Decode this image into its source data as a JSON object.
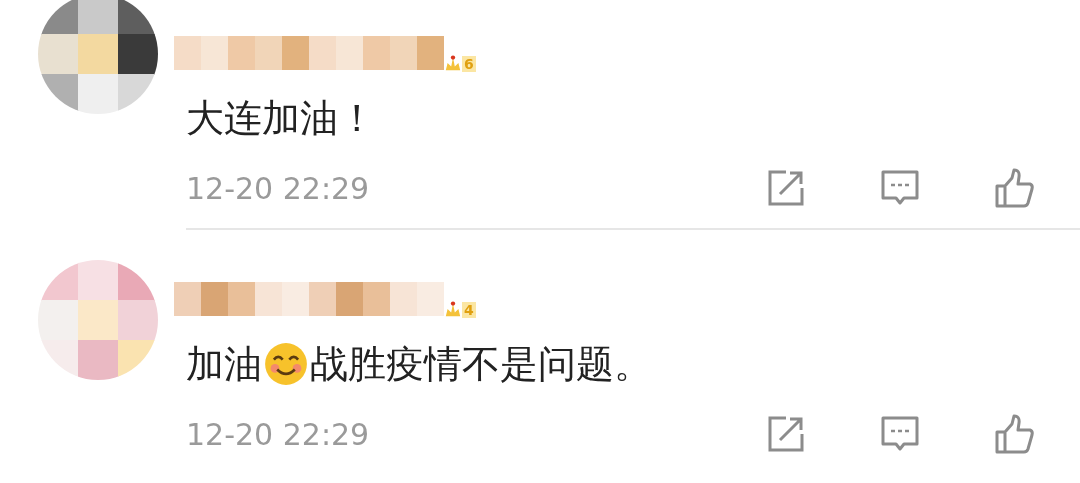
{
  "comments": [
    {
      "avatar": {
        "kind": "picture"
      },
      "name": {
        "kind": "picture"
      },
      "badge": {
        "level": "6"
      },
      "segments": [
        {
          "kind": "text",
          "text": "大连加油！"
        }
      ],
      "time": "12-20 22:29"
    },
    {
      "avatar": {
        "kind": "picture"
      },
      "name": {
        "kind": "picture"
      },
      "badge": {
        "level": "4"
      },
      "segments": [
        {
          "kind": "text",
          "text": "加油"
        },
        {
          "kind": "emoji"
        },
        {
          "kind": "text",
          "text": "战胜疫情不是问题。"
        }
      ],
      "time": "12-20 22:29"
    }
  ]
}
